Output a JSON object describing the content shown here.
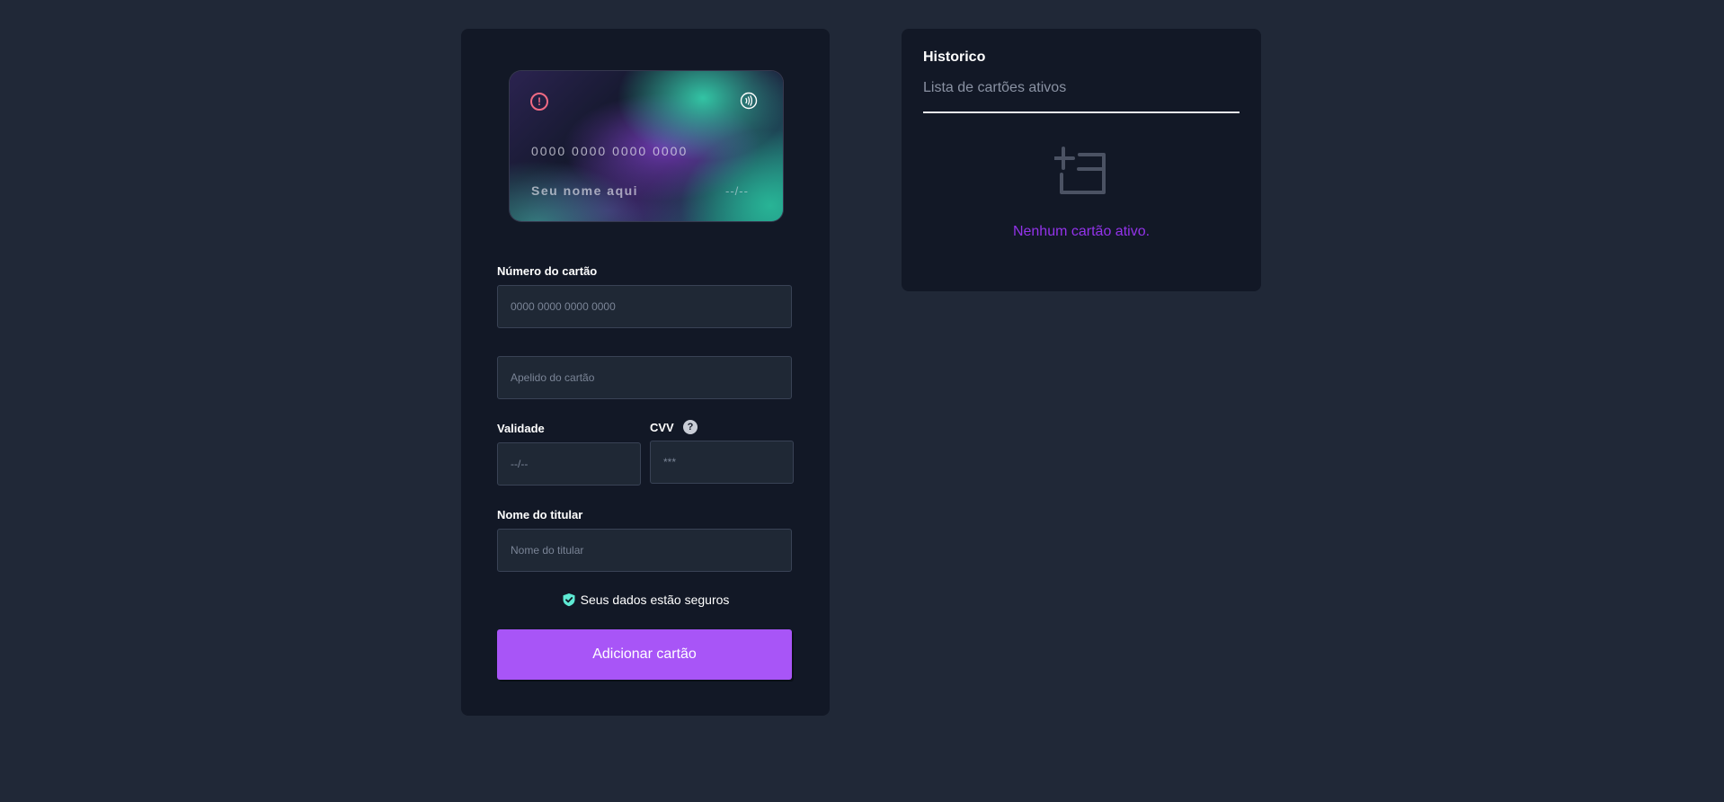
{
  "card_preview": {
    "number": "0000 0000 0000 0000",
    "holder_name": "Seu nome aqui",
    "expiry": "--/--",
    "alert_icon": "alert-circle-icon",
    "contactless_icon": "contactless-icon"
  },
  "form": {
    "card_number_label": "Número do cartão",
    "card_number_placeholder": "0000 0000 0000 0000",
    "nickname_placeholder": "Apelido do cartão",
    "expiry_label": "Validade",
    "expiry_placeholder": "--/--",
    "cvv_label": "CVV",
    "cvv_help_icon": "?",
    "cvv_placeholder": "***",
    "holder_label": "Nome do titular",
    "holder_placeholder": "Nome do titular",
    "secure_text": "Seus dados estão seguros",
    "submit_label": "Adicionar cartão"
  },
  "history": {
    "title": "Historico",
    "subtitle": "Lista de cartões ativos",
    "empty_icon": "add-card-icon",
    "empty_text": "Nenhum cartão ativo."
  },
  "colors": {
    "page_background": "#202837",
    "panel_background": "#121826",
    "accent": "#a855f7",
    "empty_text": "#9333ea",
    "shield": "#5eead4",
    "alert": "#f06a83"
  }
}
